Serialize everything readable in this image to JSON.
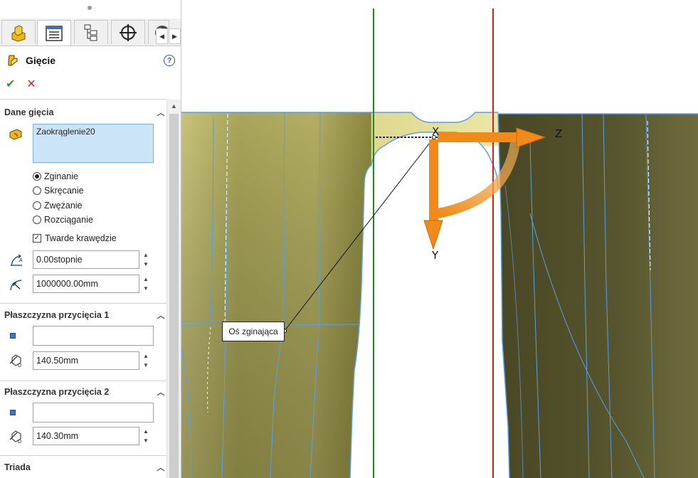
{
  "feature": {
    "title": "Gięcie",
    "help": "?"
  },
  "sections": {
    "bend_data": {
      "title": "Dane gięcia",
      "selected_entity": "Zaokrąglenie20",
      "options": [
        "Zginanie",
        "Skręcanie",
        "Zwężanie",
        "Rozciąganie"
      ],
      "selected_option": "Zginanie",
      "hard_edges_label": "Twarde krawędzie",
      "hard_edges_checked": true,
      "angle_value": "0.00stopnie",
      "radius_value": "1000000.00mm"
    },
    "trim_plane_1": {
      "title": "Płaszczyzna przycięcia 1",
      "entity": "",
      "offset_value": "140.50mm"
    },
    "trim_plane_2": {
      "title": "Płaszczyzna przycięcia 2",
      "entity": "",
      "offset_value": "140.30mm"
    },
    "triad": {
      "title": "Triada"
    }
  },
  "viewport": {
    "callout_label": "Oś zginająca",
    "axis_labels": {
      "x": "X",
      "y": "Y",
      "z": "Z"
    },
    "colors": {
      "green_line": "#1a8a1a",
      "red_line": "#d42020",
      "arrow": "#f08a1a",
      "model_light": "#c8c47a",
      "model_dark": "#5a5a30",
      "edges": "#5aa0e0"
    }
  },
  "icons": [
    "part-icon",
    "property-manager-icon",
    "configuration-icon",
    "crosshair-icon",
    "appearance-icon",
    "bend-feature-icon",
    "ok-icon",
    "cancel-icon"
  ]
}
